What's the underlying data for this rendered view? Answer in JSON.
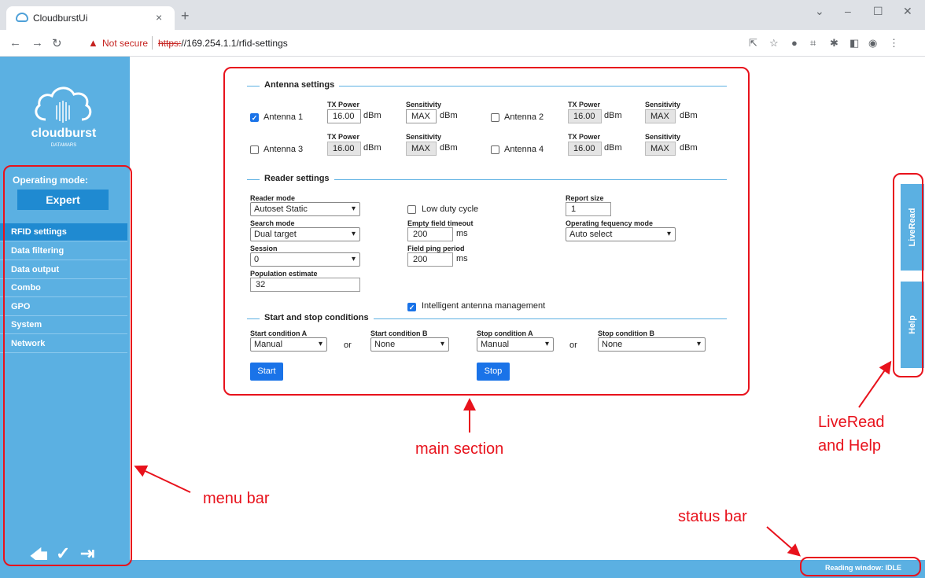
{
  "browser": {
    "tab_title": "CloudburstUi",
    "tab_close": "×",
    "new_tab": "+",
    "not_secure": "Not secure",
    "url_scheme": "https:",
    "url_rest": "//169.254.1.1/rfid-settings"
  },
  "sidebar": {
    "logo_text": "cloudburst",
    "logo_subtext": "DATAMARS",
    "operating_mode_label": "Operating mode:",
    "operating_mode_value": "Expert",
    "menu": [
      "RFID settings",
      "Data filtering",
      "Data output",
      "Combo",
      "GPO",
      "System",
      "Network"
    ],
    "active_item": "RFID settings"
  },
  "antenna_settings": {
    "title": "Antenna settings",
    "tx_power_label": "TX Power",
    "sensitivity_label": "Sensitivity",
    "unit": "dBm",
    "antennas": [
      {
        "name": "Antenna 1",
        "checked": true,
        "tx_power": "16.00",
        "sensitivity": "MAX"
      },
      {
        "name": "Antenna 2",
        "checked": false,
        "tx_power": "16.00",
        "sensitivity": "MAX"
      },
      {
        "name": "Antenna 3",
        "checked": false,
        "tx_power": "16.00",
        "sensitivity": "MAX"
      },
      {
        "name": "Antenna 4",
        "checked": false,
        "tx_power": "16.00",
        "sensitivity": "MAX"
      }
    ]
  },
  "reader_settings": {
    "title": "Reader settings",
    "reader_mode_label": "Reader mode",
    "reader_mode": "Autoset Static",
    "search_mode_label": "Search mode",
    "search_mode": "Dual target",
    "session_label": "Session",
    "session": "0",
    "population_label": "Population estimate",
    "population": "32",
    "low_duty_label": "Low duty cycle",
    "low_duty_checked": false,
    "empty_field_label": "Empty field timeout",
    "empty_field_value": "200",
    "field_ping_label": "Field ping period",
    "field_ping_value": "200",
    "ms": "ms",
    "intelligent_label": "Intelligent antenna management",
    "intelligent_checked": true,
    "report_size_label": "Report size",
    "report_size": "1",
    "freq_mode_label": "Operating fequency mode",
    "freq_mode": "Auto select"
  },
  "conditions": {
    "title": "Start and stop conditions",
    "start_a_label": "Start condition A",
    "start_a": "Manual",
    "start_b_label": "Start condition B",
    "start_b": "None",
    "stop_a_label": "Stop condition A",
    "stop_a": "Manual",
    "stop_b_label": "Stop condition B",
    "stop_b": "None",
    "or": "or",
    "start_button": "Start",
    "stop_button": "Stop"
  },
  "right_tabs": {
    "liveread": "LiveRead",
    "help": "Help"
  },
  "status": {
    "text": "Reading window: IDLE"
  },
  "annotations": {
    "main": "main section",
    "menu": "menu bar",
    "liveread_line1": "LiveRead",
    "liveread_line2": "and Help",
    "status": "status bar"
  },
  "colors": {
    "sidebar": "#5bb0e2",
    "active": "#1f8ad1",
    "button": "#1a73e8",
    "annotation": "#e8121c"
  }
}
